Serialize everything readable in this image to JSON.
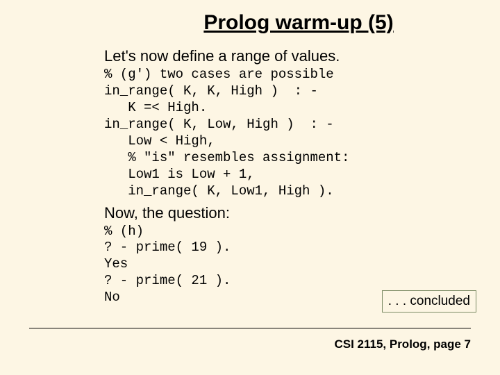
{
  "title": "Prolog warm-up (5)",
  "intro": "Let's now define a range of values.",
  "code1": "% (g') two cases are possible\nin_range( K, K, High )  : -\n   K =< High.\nin_range( K, Low, High )  : -\n   Low < High,\n   % \"is\" resembles assignment:\n   Low1 is Low + 1,\n   in_range( K, Low1, High ).",
  "question_heading": "Now, the question:",
  "code2": "% (h)\n? - prime( 19 ).\nYes\n? - prime( 21 ).\nNo",
  "concluded": ". . . concluded",
  "footer": "CSI 2115, Prolog, page 7"
}
